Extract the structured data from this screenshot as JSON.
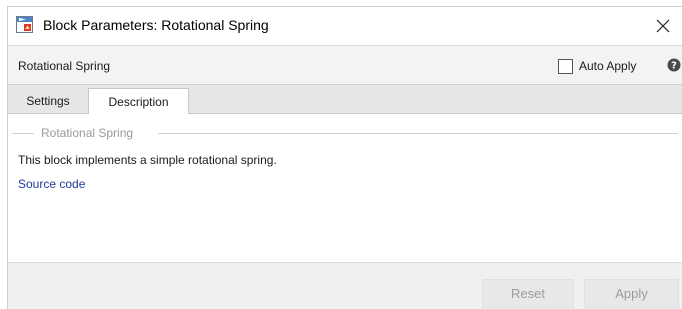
{
  "window": {
    "title": "Block Parameters: Rotational Spring"
  },
  "header": {
    "block_name": "Rotational Spring",
    "auto_apply_label": "Auto Apply",
    "auto_apply_checked": false
  },
  "tabs": [
    {
      "label": "Settings",
      "active": false
    },
    {
      "label": "Description",
      "active": true
    }
  ],
  "description": {
    "group_title": "Rotational Spring",
    "text": "This block implements a simple rotational spring.",
    "link": "Source code"
  },
  "footer": {
    "reset_label": "Reset",
    "apply_label": "Apply"
  },
  "icons": {
    "app": "simulink-block-icon",
    "close": "close-icon",
    "help": "help-icon"
  },
  "colors": {
    "link": "#1f3c9c",
    "group_title": "#9a9a9a",
    "disabled_text": "#9c9c9c"
  }
}
